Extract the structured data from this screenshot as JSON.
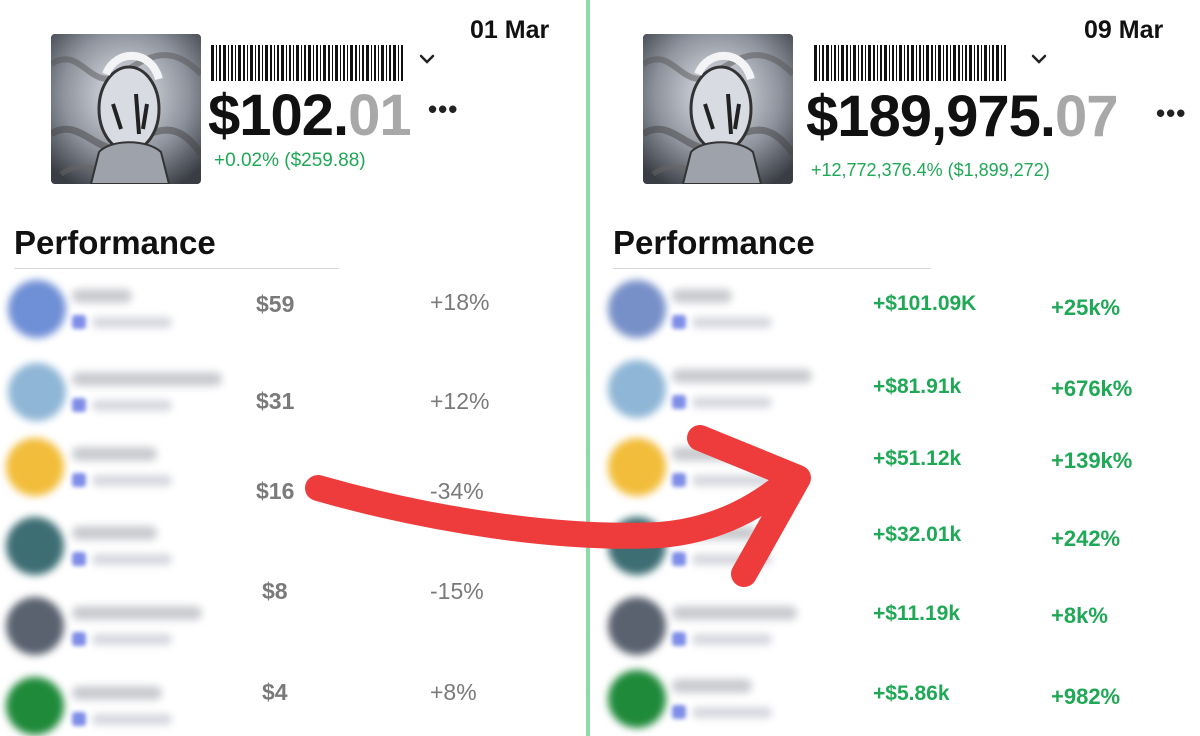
{
  "left": {
    "date": "01 Mar",
    "price_main": "$102.",
    "price_cents": "01",
    "change": "+0.02% ($259.88)",
    "performance_title": "Performance",
    "rows": [
      {
        "value": "$59",
        "percent": "+18%",
        "avatar_color": "#6f8fd6"
      },
      {
        "value": "$31",
        "percent": "+12%",
        "avatar_color": "#8fb6d6"
      },
      {
        "value": "$16",
        "percent": "-34%",
        "avatar_color": "#f2bd3a"
      },
      {
        "value": "$8",
        "percent": "-15%",
        "avatar_color": "#3d6e74"
      },
      {
        "value": "$4",
        "percent": "+8%",
        "avatar_color": "#5a6270"
      }
    ]
  },
  "right": {
    "date": "09 Mar",
    "price_main": "$189,975.",
    "price_cents": "07",
    "change": "+12,772,376.4% ($1,899,272)",
    "performance_title": "Performance",
    "rows": [
      {
        "value": "+$101.09K",
        "percent": "+25k%",
        "avatar_color": "#7790c8"
      },
      {
        "value": "+$81.91k",
        "percent": "+676k%",
        "avatar_color": "#8fb6d6"
      },
      {
        "value": "+$51.12k",
        "percent": "+139k%",
        "avatar_color": "#f2bd3a"
      },
      {
        "value": "+$32.01k",
        "percent": "+242%",
        "avatar_color": "#3d6e74"
      },
      {
        "value": "+$11.19k",
        "percent": "+8k%",
        "avatar_color": "#5a6270"
      },
      {
        "value": "+$5.86k",
        "percent": "+982%",
        "avatar_color": "#1f8a3a"
      }
    ]
  },
  "icons": {
    "chevron": "chevron-down-icon",
    "more": "more-horizontal-icon",
    "arrow": "red-curved-arrow",
    "barcode": "barcode-icon"
  },
  "colors": {
    "positive": "#1fa855",
    "divider": "#8fd8a8",
    "arrow": "#ee3b3b",
    "muted": "#a8a8a8"
  }
}
